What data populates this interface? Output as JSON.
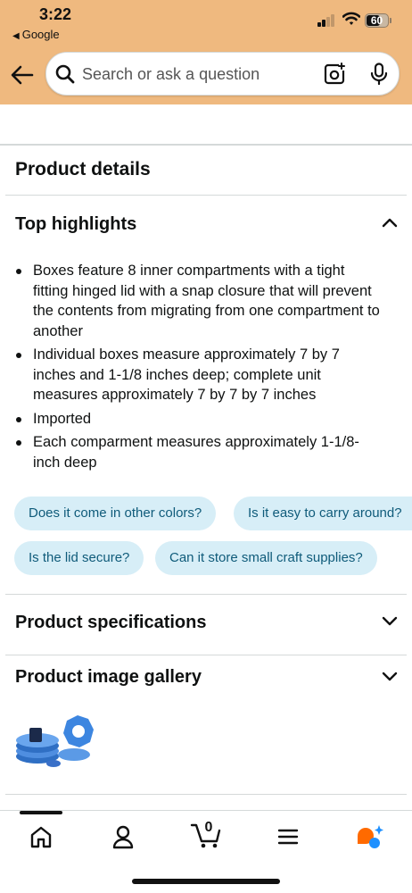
{
  "status_bar": {
    "time": "3:22",
    "back_app": "Google",
    "battery": "60"
  },
  "search": {
    "placeholder": "Search or ask a question"
  },
  "sections": {
    "product_details": "Product details",
    "top_highlights": "Top highlights",
    "product_specifications": "Product specifications",
    "product_image_gallery": "Product image gallery"
  },
  "highlights": [
    "Boxes feature 8 inner compartments with a tight fitting hinged lid with a snap closure that will prevent the contents from migrating from one compartment to another",
    "Individual boxes measure approximately 7 by 7 inches and 1-1/8 inches deep; complete unit measures approximately 7 by 7 by 7 inches",
    "Imported",
    "Each comparment measures approximately 1-1/8-inch deep"
  ],
  "questions": [
    "Does it come in other colors?",
    "Is it easy to carry around?",
    "Is the lid secure?",
    "Can it store small craft supplies?"
  ],
  "cart": {
    "count": "0"
  },
  "colors": {
    "header_bg": "#efb97f",
    "chip_bg": "#d7eef7",
    "chip_text": "#0f5b7a",
    "rufus_orange": "#ff6a00",
    "rufus_blue": "#1e90ff"
  },
  "icons": [
    "back-arrow-icon",
    "search-icon",
    "camera-lens-icon",
    "microphone-icon",
    "chevron-up-icon",
    "chevron-down-icon",
    "home-icon",
    "account-icon",
    "cart-icon",
    "menu-icon",
    "rufus-icon"
  ]
}
